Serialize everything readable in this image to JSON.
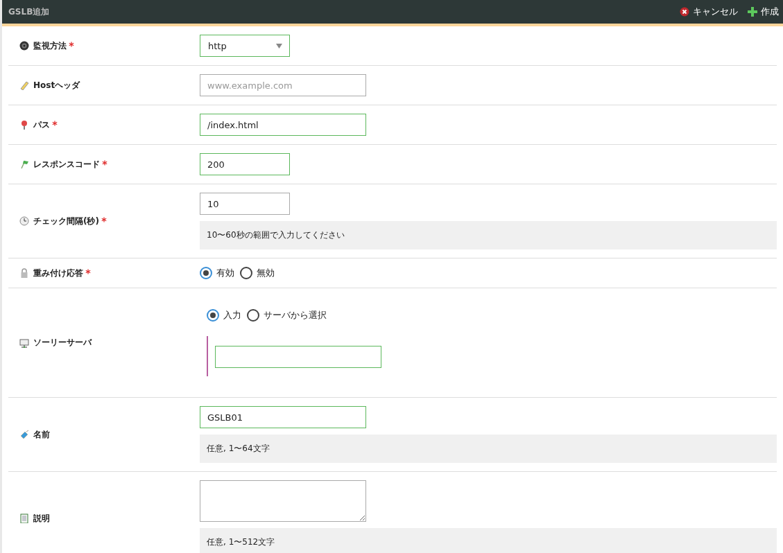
{
  "header": {
    "title": "GSLB追加",
    "actions": [
      {
        "kind": "cancel",
        "label": "キャンセル"
      },
      {
        "kind": "create",
        "label": "作成"
      }
    ]
  },
  "rows": [
    {
      "kind": "select",
      "label": "監視方法",
      "required": true,
      "value": "http",
      "valid": true
    },
    {
      "kind": "input",
      "label": "Hostヘッダ",
      "required": false,
      "placeholder": "www.example.com",
      "valid": false
    },
    {
      "kind": "input",
      "label": "パス",
      "required": true,
      "value": "/index.html",
      "valid": true
    },
    {
      "kind": "short_input",
      "label": "レスポンスコード",
      "required": true,
      "value": "200",
      "valid": true
    },
    {
      "kind": "short_input",
      "label": "チェック間隔(秒)",
      "required": true,
      "value": "10",
      "valid": false,
      "hint": "10〜60秒の範囲で入力してください"
    },
    {
      "kind": "radios",
      "label": "重み付け応答",
      "required": true,
      "options": [
        {
          "label": "有効",
          "selected": true
        },
        {
          "label": "無効",
          "selected": false
        }
      ]
    },
    {
      "kind": "sorry",
      "label": "ソーリーサーバ",
      "required": false,
      "options": [
        {
          "label": "入力",
          "selected": true
        },
        {
          "label": "サーバから選択",
          "selected": false
        }
      ],
      "valid": true
    },
    {
      "kind": "input",
      "label": "名前",
      "required": false,
      "value": "GSLB01",
      "valid": true,
      "hint": "任意, 1〜64文字"
    },
    {
      "kind": "textarea",
      "label": "説明",
      "required": false,
      "valid": false,
      "hint": "任意, 1〜512文字"
    }
  ]
}
